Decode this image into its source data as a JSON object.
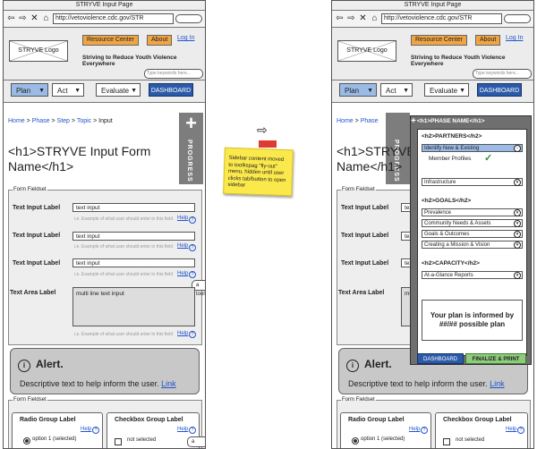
{
  "browser": {
    "title": "STRYVE Input Page",
    "url": "http://vetoviolence.cdc.gov/STR"
  },
  "header": {
    "logo": "STRYVE Logo",
    "resource_center": "Resource Center",
    "about": "About",
    "login": "Log In",
    "tagline": "Striving to Reduce Youth Violence Everywhere",
    "search_placeholder": "Type keywords here..."
  },
  "nav": {
    "plan": "Plan",
    "act": "Act",
    "evaluate": "Evaluate",
    "dashboard": "DASHBOARD"
  },
  "breadcrumb": {
    "home": "Home",
    "phase": "Phase",
    "step": "Step",
    "topic": "Topic",
    "current": "Input"
  },
  "progress_tab": {
    "label": "PROGRESS"
  },
  "page": {
    "h1": "<h1>STRYVE Input Form Name</h1>"
  },
  "form1": {
    "legend": "Form Fieldset",
    "fields": [
      {
        "label": "Text Input Label",
        "value": "text input",
        "hint": "i.e. Example of what user should enter in this field",
        "help": "Help"
      },
      {
        "label": "Text Input Label",
        "value": "text input",
        "hint": "i.e. Example of what user should enter in this field",
        "help": "Help"
      },
      {
        "label": "Text Input Label",
        "value": "text input",
        "hint": "i.e. Example of what user should enter in this field",
        "help": "Help"
      }
    ],
    "textarea_label": "Text Area Label",
    "textarea_value": "multi line text input",
    "textarea_hint": "i.e. Example of what user should enter in this field",
    "textarea_help": "Help",
    "tooltip": "a tooltip"
  },
  "alert": {
    "title": "Alert.",
    "desc": "Descriptive text to help inform the user.",
    "link": "Link"
  },
  "form2": {
    "legend": "Form Fieldset",
    "radio_title": "Radio Group Label",
    "radio_help": "Help",
    "radio_option": "option 1 (selected)",
    "checkbox_title": "Checkbox Group Label",
    "checkbox_help": "Help",
    "checkbox_option": "not selected",
    "tooltip": "a tooltip"
  },
  "annotation": {
    "note": "Sidebar content moved to toolkspag \"fly-out\" menu, hidden until user clicks tab/button to open sidebar"
  },
  "sidebar": {
    "title": "<h1>PHASE NAME</h1>",
    "partners_heading": "<h2>PARTNERS</h2>",
    "item_identify": "Identify New & Existing",
    "sub_member": "Member Profiles",
    "item_infrastructure": "Infrastructure",
    "goals_heading": "<h2>GOALS</h2>",
    "goals": [
      "Prevalence",
      "Community Needs & Assets",
      "Goals & Outcomes",
      "Creating a Mission & Vision"
    ],
    "capacity_heading": "<h2>CAPACITY</h2>",
    "item_glance": "At-a-Glance Reports",
    "plan_info": "Your plan is informed by ##/## possible plan",
    "dashboard": "DASHBOARD",
    "finalize": "FINALIZE & PRINT"
  }
}
